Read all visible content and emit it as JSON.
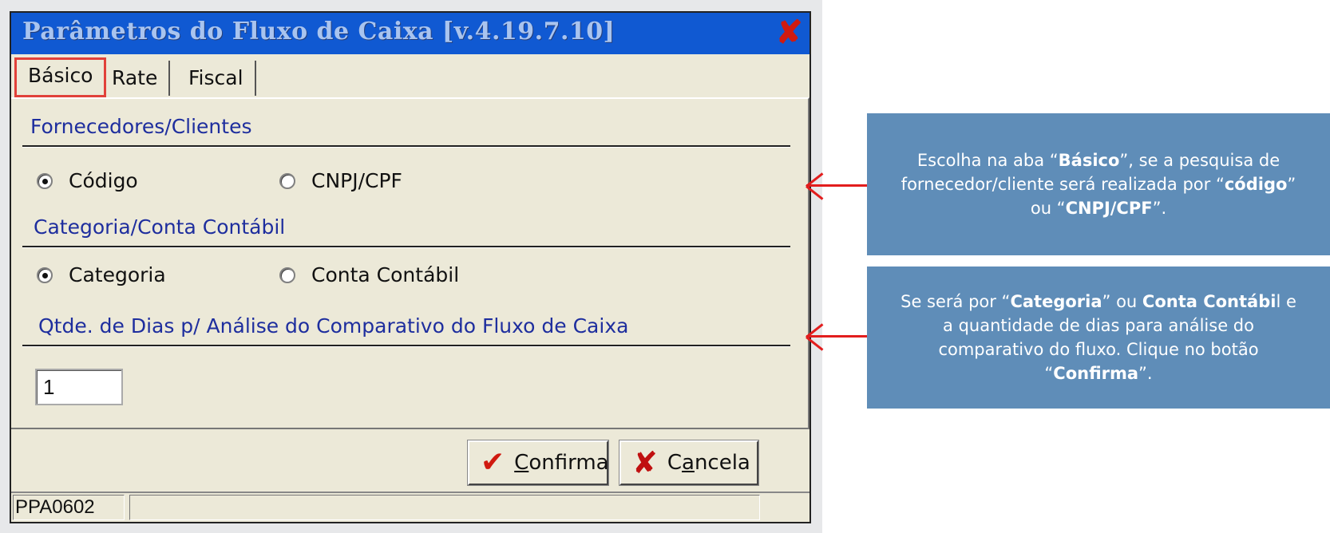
{
  "window": {
    "title": "Parâmetros do Fluxo de Caixa [v.4.19.7.10]",
    "close_glyph": "✘"
  },
  "tabs": [
    {
      "label": "Básico",
      "active": true
    },
    {
      "label": "Rate",
      "active": false
    },
    {
      "label": "Fiscal",
      "active": false
    }
  ],
  "sections": {
    "fornecedores": {
      "title": "Fornecedores/Clientes",
      "options": [
        {
          "label": "Código",
          "selected": true
        },
        {
          "label": "CNPJ/CPF",
          "selected": false
        }
      ]
    },
    "categoria": {
      "title": "Categoria/Conta Contábil",
      "options": [
        {
          "label": "Categoria",
          "selected": true
        },
        {
          "label": "Conta Contábil",
          "selected": false
        }
      ]
    },
    "dias": {
      "title": "Qtde. de Dias p/ Análise do Comparativo do Fluxo de Caixa",
      "value": "1"
    }
  },
  "buttons": {
    "confirma": {
      "pre": "",
      "mnemonic": "C",
      "rest": "onfirma"
    },
    "cancela": {
      "pre": "C",
      "mnemonic": "a",
      "rest": "ncela"
    }
  },
  "statusbar": {
    "code": "PPA0602",
    "message": ""
  },
  "callouts": {
    "first": {
      "t1": "Escolha na aba “",
      "b1": "Básico",
      "t2": "”, se a pesquisa de fornecedor/cliente será realizada por “",
      "b2": "código",
      "t3": "” ou “",
      "b3": "CNPJ/CPF",
      "t4": "”."
    },
    "second": {
      "t1": "Se será por “",
      "b1": "Categoria",
      "t2": "” ou ",
      "b2": "Conta Contábi",
      "t3": "l e a quantidade de dias para análise do comparativo do fluxo. Clique no botão “",
      "b3": "Confirma",
      "t4": "”."
    }
  },
  "colors": {
    "titlebar": "#1059d2",
    "accent_red": "#e21d1d",
    "callout_bg": "#5f8db8",
    "section_title": "#1e2e9e"
  }
}
